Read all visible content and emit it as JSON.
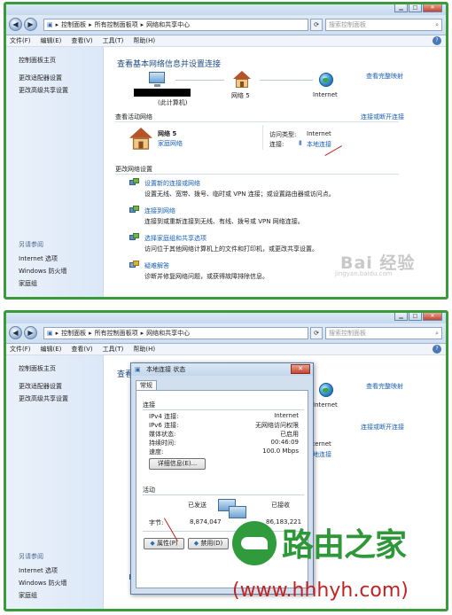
{
  "window": {
    "breadcrumb": [
      "控制面板",
      "所有控制面板项",
      "网络和共享中心"
    ],
    "search_placeholder": "搜索控制面板",
    "menu": [
      "文件(F)",
      "编辑(E)",
      "查看(V)",
      "工具(T)",
      "帮助(H)"
    ],
    "minimize": "▁",
    "maximize": "□",
    "close": "✕"
  },
  "sidebar": {
    "items": [
      "控制面板主页",
      "更改适配器设置",
      "更改高级共享设置"
    ],
    "see_also_heading": "另请参阅",
    "see_also": [
      "Internet 选项",
      "Windows 防火墙",
      "家庭组"
    ]
  },
  "main": {
    "heading": "查看基本网络信息并设置连接",
    "view_full_map": "查看完整映射",
    "map_nodes": [
      "(此计算机)",
      "网络  5",
      "Internet"
    ],
    "active_networks_heading": "查看活动网络",
    "connect_or_disconnect": "连接或断开连接",
    "network_name": "网络  5",
    "network_type": "家庭网络",
    "access_type_label": "访问类型:",
    "access_type_value": "Internet",
    "connections_label": "连接:",
    "connection_link": "本地连接",
    "change_settings_heading": "更改网络设置",
    "tasks": [
      {
        "title": "设置新的连接或网络",
        "desc": "设置无线、宽带、拨号、临时或 VPN 连接；或设置路由器或访问点。"
      },
      {
        "title": "连接到网络",
        "desc": "连接到或重新连接到无线、有线、拨号或 VPN 网络连接。"
      },
      {
        "title": "选择家庭组和共享选项",
        "desc": "访问位于其他网络计算机上的文件和打印机，或更改共享设置。"
      },
      {
        "title": "疑难解答",
        "desc": "诊断并修复网络问题，或获得故障排除信息。"
      }
    ]
  },
  "dialog": {
    "title": "本地连接 状态",
    "close": "✕",
    "tab": "常规",
    "connection_heading": "连接",
    "rows": [
      {
        "label": "IPv4 连接:",
        "value": "Internet"
      },
      {
        "label": "IPv6 连接:",
        "value": "无网络访问权限"
      },
      {
        "label": "媒体状态:",
        "value": "已启用"
      },
      {
        "label": "持续时间:",
        "value": "00:46:09"
      },
      {
        "label": "速度:",
        "value": "100.0 Mbps"
      }
    ],
    "details_button": "详细信息(E)...",
    "activity_heading": "活动",
    "sent_label": "已发送",
    "received_label": "已接收",
    "bytes_label": "字节:",
    "sent_bytes": "8,874,047",
    "received_bytes": "86,183,221",
    "properties_button": "属性(P)",
    "disable_button": "禁用(D)"
  },
  "watermarks": {
    "baidu": "Bai 经验",
    "baidu_url": "jingyan.baidu.com",
    "site_name": "路由之家",
    "site_url": "(www.hhhyh.com)"
  }
}
